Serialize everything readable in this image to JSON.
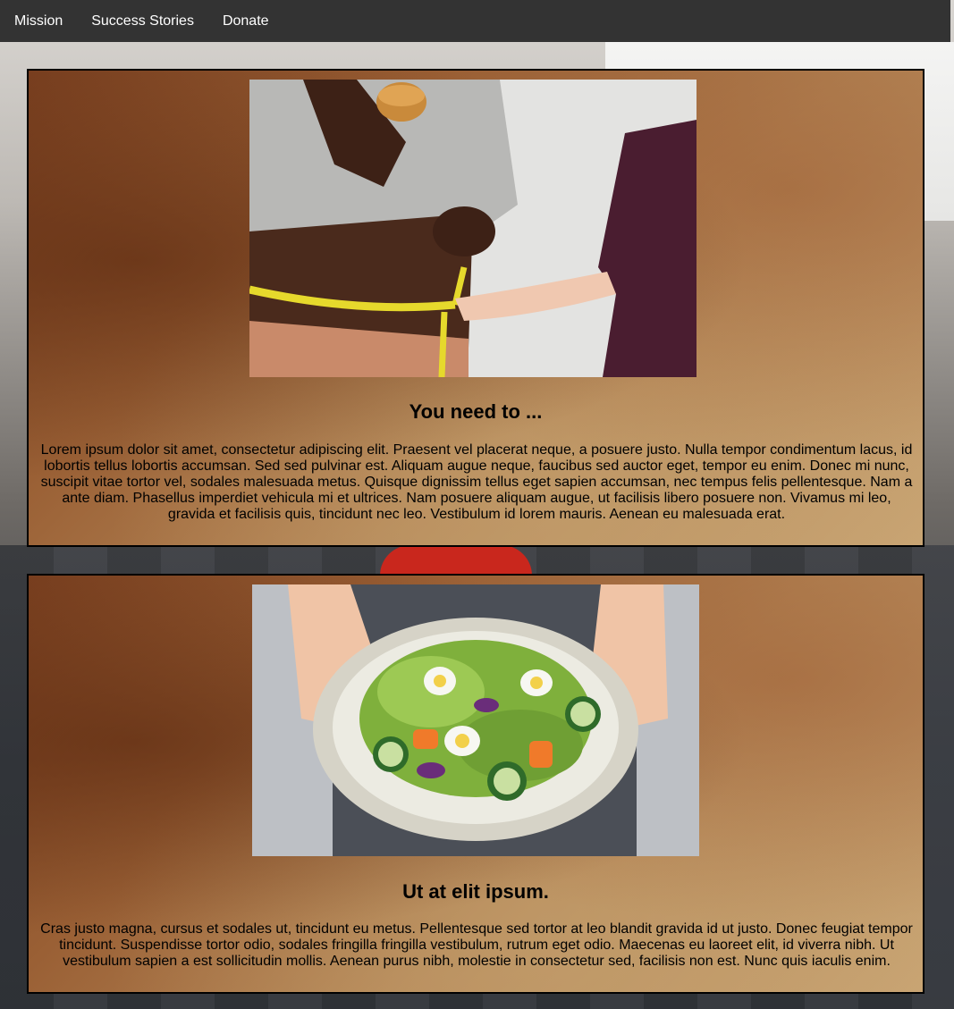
{
  "nav": {
    "items": [
      {
        "label": "Mission"
      },
      {
        "label": "Success Stories"
      },
      {
        "label": "Donate"
      }
    ]
  },
  "cards": [
    {
      "image_subject": "person measuring waist with tape measure while holding a burger",
      "title": "You need to ...",
      "text": "Lorem ipsum dolor sit amet, consectetur adipiscing elit. Praesent vel placerat neque, a posuere justo. Nulla tempor condimentum lacus, id lobortis tellus lobortis accumsan. Sed sed pulvinar est. Aliquam augue neque, faucibus sed auctor eget, tempor eu enim. Donec mi nunc, suscipit vitae tortor vel, sodales malesuada metus. Quisque dignissim tellus eget sapien accumsan, nec tempus felis pellentesque. Nam a ante diam. Phasellus imperdiet vehicula mi et ultrices. Nam posuere aliquam augue, ut facilisis libero posuere non. Vivamus mi leo, gravida et facilisis quis, tincidunt nec leo. Vestibulum id lorem mauris. Aenean eu malesuada erat."
    },
    {
      "image_subject": "hands holding a plate of green salad with eggs, cucumber and carrots",
      "title": "Ut at elit ipsum.",
      "text": "Cras justo magna, cursus et sodales ut, tincidunt eu metus. Pellentesque sed tortor at leo blandit gravida id ut justo. Donec feugiat tempor tincidunt. Suspendisse tortor odio, sodales fringilla fringilla vestibulum, rutrum eget odio. Maecenas eu laoreet elit, id viverra nibh. Ut vestibulum sapien a est sollicitudin mollis. Aenean purus nibh, molestie in consectetur sed, facilisis non est. Nunc quis iaculis enim."
    }
  ],
  "colors": {
    "nav_bg": "#333333",
    "nav_text": "#ffffff",
    "card_border": "#000000",
    "parchment": "#b58858"
  }
}
